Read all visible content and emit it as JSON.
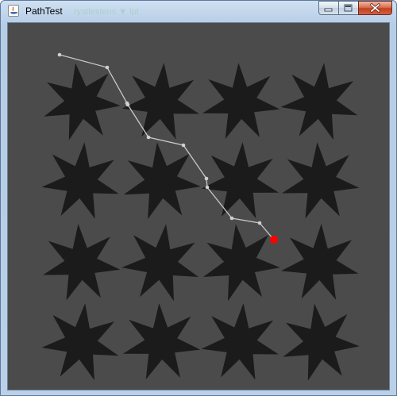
{
  "window": {
    "title": "PathTest",
    "background_title_text": "ryatlestens ▼ lpt",
    "controls": {
      "minimize": "minimize-icon",
      "maximize": "maximize-icon",
      "close": "close-icon"
    }
  },
  "canvas": {
    "background_color": "#4b4b4b",
    "star_color": "#1b1b1b",
    "star_points": 7,
    "star_grid": {
      "rows": 4,
      "columns": 4
    },
    "path_color": "#c8c8c8",
    "path_node_color": "#d0d0d0",
    "target_color": "#ff0000"
  }
}
